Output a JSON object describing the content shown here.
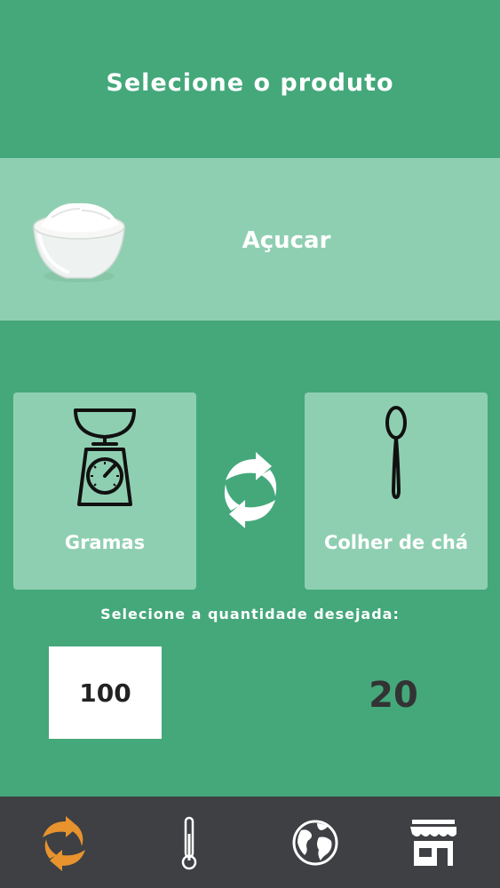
{
  "header": {
    "title": "Selecione o produto"
  },
  "product": {
    "name": "Açucar",
    "image_icon": "sugar-bowl"
  },
  "units": {
    "from": {
      "label": "Gramas",
      "icon": "kitchen-scale"
    },
    "to": {
      "label": "Colher de chá",
      "icon": "teaspoon"
    },
    "swap_icon": "swap-arrows"
  },
  "quantity": {
    "caption": "Selecione a quantidade desejada:",
    "input_value": "100",
    "result": "20"
  },
  "nav": {
    "items": [
      {
        "icon": "swap-arrows",
        "active": true
      },
      {
        "icon": "thermometer",
        "active": false
      },
      {
        "icon": "globe",
        "active": false
      },
      {
        "icon": "store",
        "active": false
      }
    ]
  },
  "colors": {
    "background": "#44a87b",
    "panel": "#8fcfb1",
    "nav_background": "#3e4043",
    "nav_active": "#e8932e",
    "nav_inactive": "#ffffff",
    "result_text": "#333333"
  }
}
